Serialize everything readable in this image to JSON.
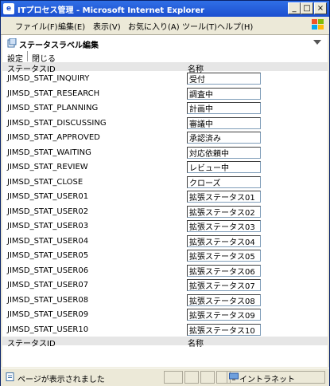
{
  "window": {
    "title": "ITプロセス管理 - Microsoft Internet Explorer"
  },
  "menu": [
    "ファイル(F)",
    "編集(E)",
    "表示(V)",
    "お気に入り(A)",
    "ツール(T)",
    "ヘルプ(H)"
  ],
  "window_buttons": {
    "minimize": "_",
    "maximize": "□",
    "close": "×"
  },
  "panel": {
    "title": "ステータスラベル編集"
  },
  "toolbar": {
    "settings": "設定",
    "close": "閉じる"
  },
  "table": {
    "header": {
      "id": "ステータスID",
      "name": "名称"
    },
    "footer": {
      "id": "ステータスID",
      "name": "名称"
    },
    "rows": [
      {
        "id": "JIMSD_STAT_INQUIRY",
        "name": "受付"
      },
      {
        "id": "JIMSD_STAT_RESEARCH",
        "name": "調査中"
      },
      {
        "id": "JIMSD_STAT_PLANNING",
        "name": "計画中"
      },
      {
        "id": "JIMSD_STAT_DISCUSSING",
        "name": "審議中"
      },
      {
        "id": "JIMSD_STAT_APPROVED",
        "name": "承認済み"
      },
      {
        "id": "JIMSD_STAT_WAITING",
        "name": "対応依頼中"
      },
      {
        "id": "JIMSD_STAT_REVIEW",
        "name": "レビュー中"
      },
      {
        "id": "JIMSD_STAT_CLOSE",
        "name": "クローズ"
      },
      {
        "id": "JIMSD_STAT_USER01",
        "name": "拡張ステータス01"
      },
      {
        "id": "JIMSD_STAT_USER02",
        "name": "拡張ステータス02"
      },
      {
        "id": "JIMSD_STAT_USER03",
        "name": "拡張ステータス03"
      },
      {
        "id": "JIMSD_STAT_USER04",
        "name": "拡張ステータス04"
      },
      {
        "id": "JIMSD_STAT_USER05",
        "name": "拡張ステータス05"
      },
      {
        "id": "JIMSD_STAT_USER06",
        "name": "拡張ステータス06"
      },
      {
        "id": "JIMSD_STAT_USER07",
        "name": "拡張ステータス07"
      },
      {
        "id": "JIMSD_STAT_USER08",
        "name": "拡張ステータス08"
      },
      {
        "id": "JIMSD_STAT_USER09",
        "name": "拡張ステータス09"
      },
      {
        "id": "JIMSD_STAT_USER10",
        "name": "拡張ステータス10"
      }
    ]
  },
  "status": {
    "text": "ページが表示されました",
    "zone": "イントラネット"
  },
  "colors": {
    "titlebar": "#1c4fcf",
    "chrome": "#ece9d8",
    "header_row": "#e6e6e6"
  }
}
